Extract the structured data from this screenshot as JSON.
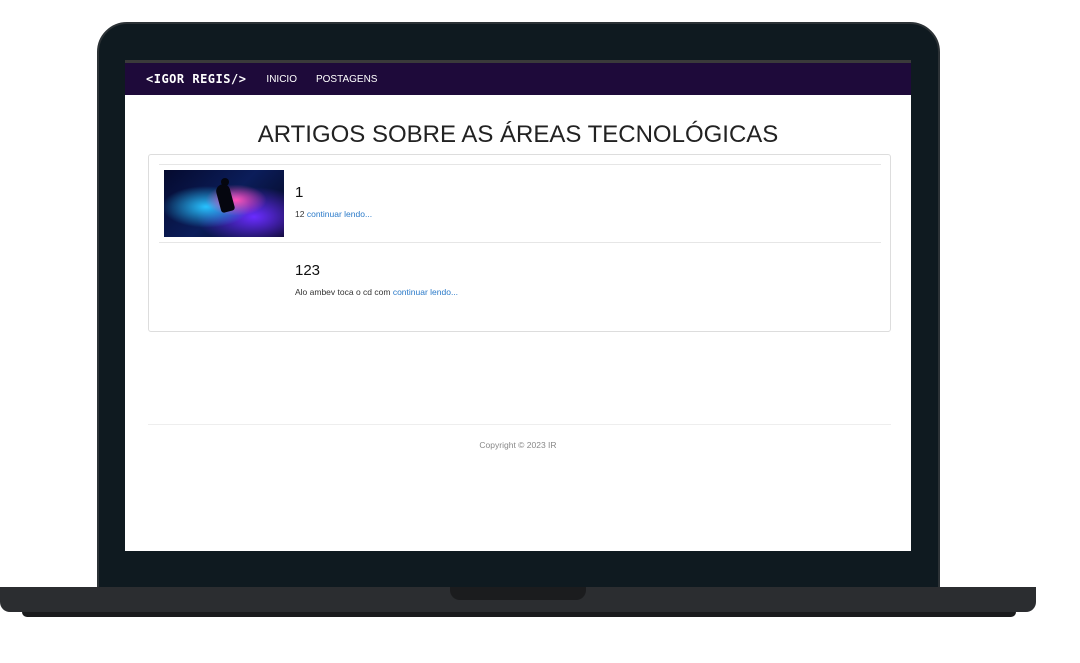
{
  "navbar": {
    "brand": "<IGOR REGIS/>",
    "links": [
      "INICIO",
      "POSTAGENS"
    ]
  },
  "page": {
    "title": "ARTIGOS SOBRE AS ÁREAS TECNOLÓGICAS"
  },
  "posts": [
    {
      "title": "1",
      "excerpt": "12",
      "read_more": "continuar lendo..."
    },
    {
      "title": "123",
      "excerpt": "Alo ambev toca o cd com",
      "read_more": "continuar lendo..."
    }
  ],
  "footer": {
    "copyright": "Copyright © 2023 IR"
  },
  "colors": {
    "navbar": "#1e0a3a",
    "link": "#2a7ac9"
  }
}
